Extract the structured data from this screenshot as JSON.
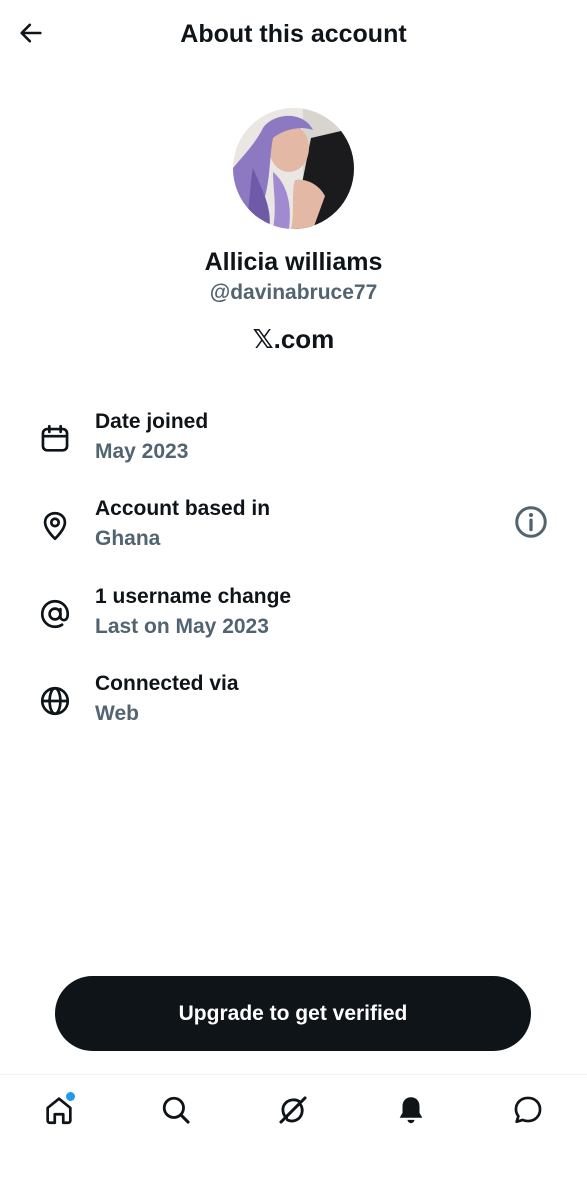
{
  "header": {
    "title": "About this account",
    "back_icon": "arrow-left-icon"
  },
  "profile": {
    "display_name": "Allicia williams",
    "handle": "@davinabruce77",
    "site": "𝕏.com"
  },
  "info_rows": [
    {
      "icon": "calendar-icon",
      "title": "Date joined",
      "value": "May 2023"
    },
    {
      "icon": "location-pin-icon",
      "title": "Account based in",
      "value": "Ghana",
      "trailing_icon": "info-icon"
    },
    {
      "icon": "at-sign-icon",
      "title": "1 username change",
      "value": "Last on May 2023"
    },
    {
      "icon": "globe-icon",
      "title": "Connected via",
      "value": "Web"
    }
  ],
  "cta": {
    "label": "Upgrade to get verified"
  },
  "bottom_nav": {
    "tabs": [
      "home-icon",
      "search-icon",
      "grok-icon",
      "bell-icon",
      "messages-icon"
    ],
    "home_badge_color": "#1d9bf0"
  },
  "colors": {
    "text_primary": "#0f1419",
    "text_secondary": "#536471",
    "button_bg": "#0f1419",
    "accent": "#1d9bf0"
  }
}
